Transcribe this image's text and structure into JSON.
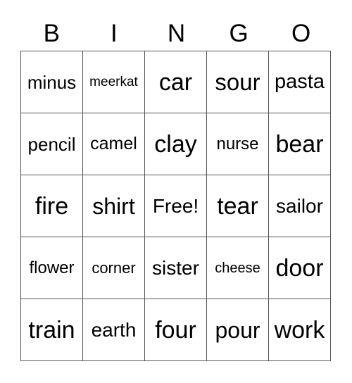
{
  "header": [
    "B",
    "I",
    "N",
    "G",
    "O"
  ],
  "rows": [
    [
      {
        "t": "minus",
        "s": 26
      },
      {
        "t": "meerkat",
        "s": 19
      },
      {
        "t": "car",
        "s": 34
      },
      {
        "t": "sour",
        "s": 33
      },
      {
        "t": "pasta",
        "s": 29
      }
    ],
    [
      {
        "t": "pencil",
        "s": 26
      },
      {
        "t": "camel",
        "s": 25
      },
      {
        "t": "clay",
        "s": 34
      },
      {
        "t": "nurse",
        "s": 24
      },
      {
        "t": "bear",
        "s": 34
      }
    ],
    [
      {
        "t": "fire",
        "s": 34
      },
      {
        "t": "shirt",
        "s": 32
      },
      {
        "t": "Free!",
        "s": 28
      },
      {
        "t": "tear",
        "s": 34
      },
      {
        "t": "sailor",
        "s": 28
      }
    ],
    [
      {
        "t": "flower",
        "s": 24
      },
      {
        "t": "corner",
        "s": 22
      },
      {
        "t": "sister",
        "s": 28
      },
      {
        "t": "cheese",
        "s": 20
      },
      {
        "t": "door",
        "s": 34
      }
    ],
    [
      {
        "t": "train",
        "s": 34
      },
      {
        "t": "earth",
        "s": 28
      },
      {
        "t": "four",
        "s": 34
      },
      {
        "t": "pour",
        "s": 32
      },
      {
        "t": "work",
        "s": 34
      }
    ]
  ]
}
